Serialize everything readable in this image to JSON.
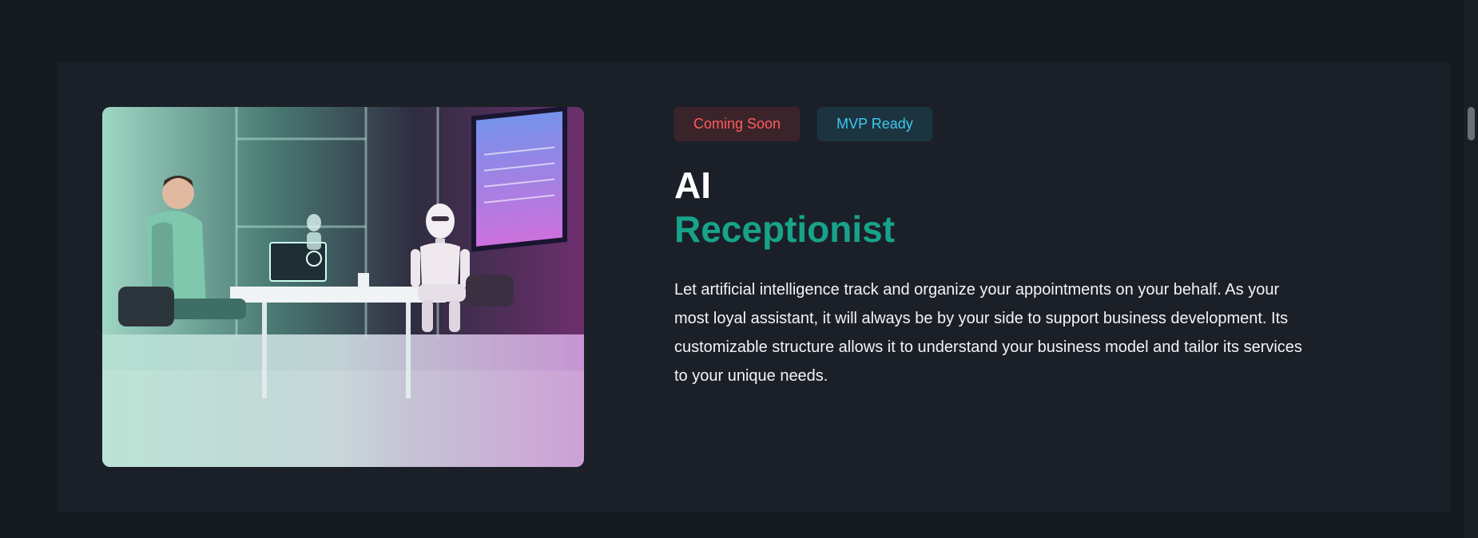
{
  "product": {
    "badges": {
      "status": "Coming Soon",
      "stage": "MVP Ready"
    },
    "title_line1": "AI",
    "title_line2": "Receptionist",
    "description": "Let artificial intelligence track and organize your appointments on your behalf. As your most loyal assistant, it will always be by your side to support business development. Its customizable structure allows it to understand your business model and tailor its services to your unique needs.",
    "image": {
      "subject": "ai-receptionist-robot-illustration"
    }
  },
  "colors": {
    "page_background": "#151a21",
    "card_background": "#1b2028",
    "status_badge_text": "#ff5c5c",
    "stage_badge_text": "#3ec8f0",
    "accent_title": "#17a38a"
  }
}
